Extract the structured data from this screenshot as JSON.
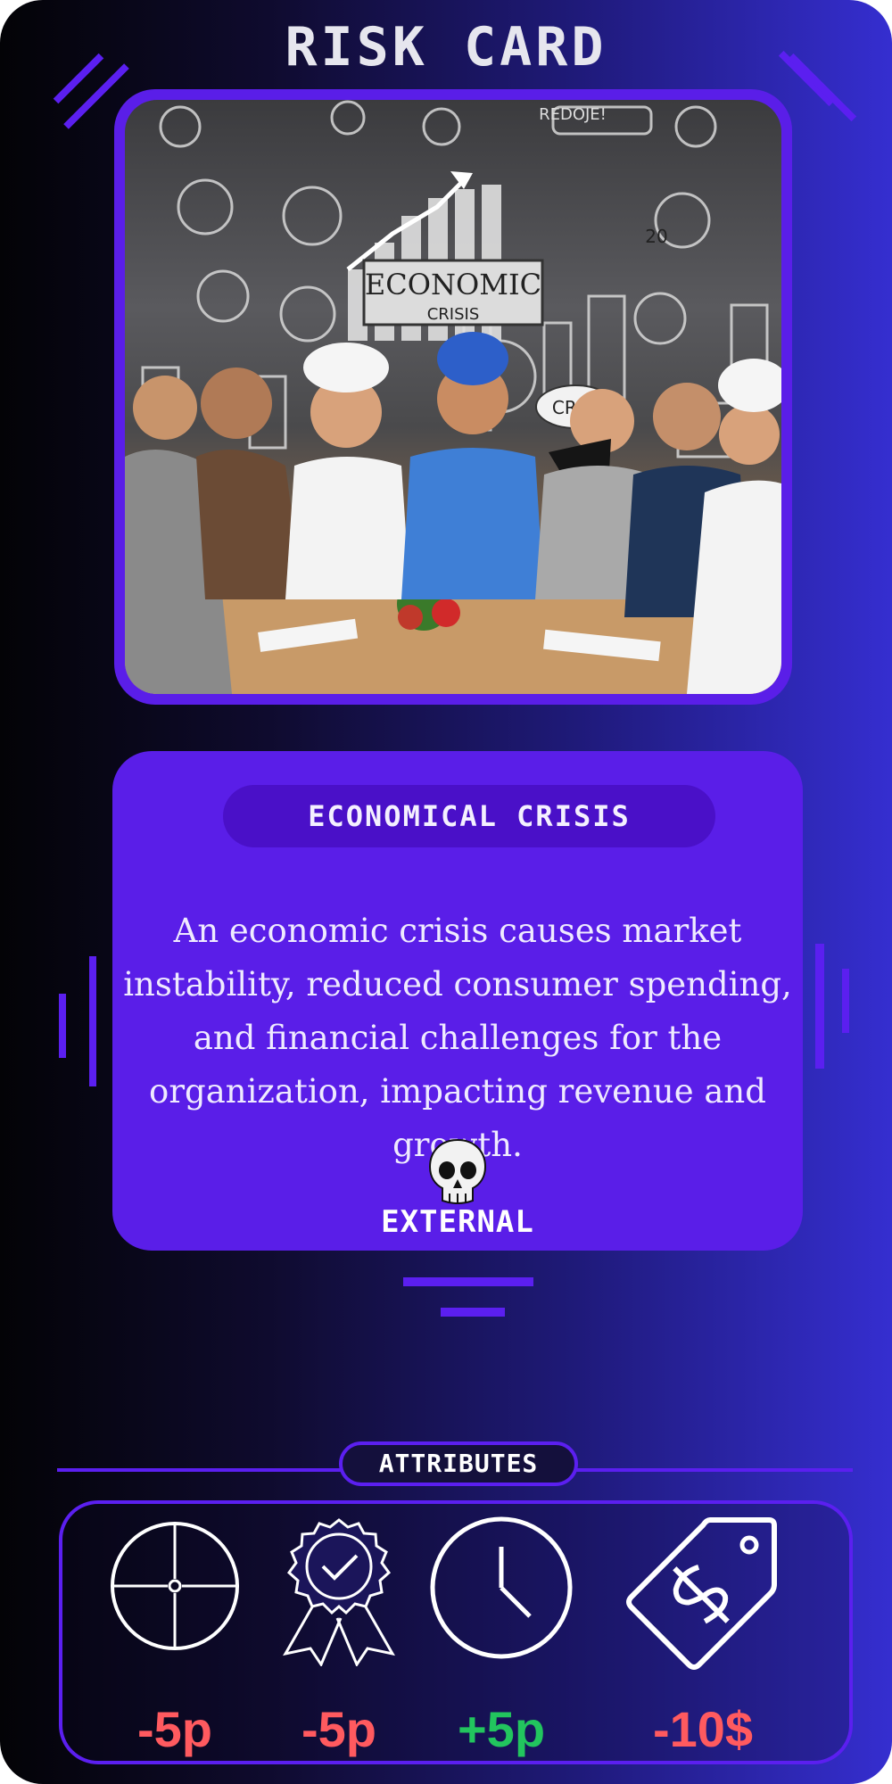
{
  "card": {
    "title": "RISK CARD",
    "image": {
      "label": "economic-crisis-illustration",
      "board_text": "ECONOMIC",
      "board_subtext": "CRISIS",
      "bubble_text": "CRAF",
      "doodle_text": "REDOJE!",
      "number_text": "20"
    }
  },
  "risk": {
    "name": "ECONOMICAL CRISIS",
    "description": "An economic crisis causes market instability, reduced consumer spending, and financial challenges for the organization, impacting revenue and growth.",
    "type": "EXTERNAL",
    "type_icon": "skull-icon"
  },
  "attributes": {
    "label": "ATTRIBUTES",
    "items": [
      {
        "icon": "crosshair-icon",
        "value": "-5p",
        "color": "#ff5a5f"
      },
      {
        "icon": "award-ribbon-icon",
        "value": "-5p",
        "color": "#ff5a5f"
      },
      {
        "icon": "clock-icon",
        "value": "+5p",
        "color": "#22c55e"
      },
      {
        "icon": "price-tag-dollar-icon",
        "value": "-10$",
        "color": "#ff5a5f"
      }
    ]
  },
  "colors": {
    "accent": "#5a1ee8",
    "panel": "#5a1ee8",
    "negative": "#ff5a5f",
    "positive": "#22c55e"
  }
}
